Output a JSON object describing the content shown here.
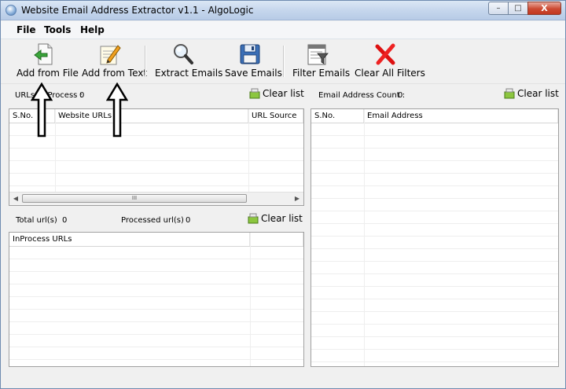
{
  "window": {
    "title": "Website Email Address Extractor v1.1 - AlgoLogic",
    "minimize": "–",
    "maximize": "□",
    "close": "X"
  },
  "menu": [
    "File",
    "Tools",
    "Help"
  ],
  "toolbar": {
    "add_from_file": "Add from File",
    "add_from_text": "Add from Text",
    "extract_emails": "Extract Emails",
    "save_emails": "Save Emails",
    "filter_emails": "Filter Emails",
    "clear_all_filters": "Clear All Filters"
  },
  "urls_panel": {
    "count_label": "URLs to Process :",
    "count_value": "0",
    "clear_label": "Clear list",
    "columns": [
      "S.No.",
      "Website URLs",
      "URL Source"
    ],
    "scroll_thumb": "III"
  },
  "progress_panel": {
    "total_label": "Total url(s)",
    "total_value": "0",
    "processed_label": "Processed url(s)",
    "processed_value": "0",
    "clear_label": "Clear list",
    "columns": [
      "InProcess URLs",
      ""
    ]
  },
  "emails_panel": {
    "count_label": "Email Address Count :",
    "count_value": "0",
    "clear_label": "Clear list",
    "columns": [
      "S.No.",
      "Email Address"
    ]
  },
  "icons": {
    "app": "globe-icon",
    "add_file": "file-arrow-icon",
    "add_text": "pencil-note-icon",
    "extract": "magnifier-icon",
    "save": "floppy-disk-icon",
    "filter": "filter-list-icon",
    "clear_filters": "red-x-icon",
    "clear_list": "eraser-icon"
  },
  "colors": {
    "titlebar": "#c4d5ec",
    "close_button": "#cc4a33",
    "annotation_arrow": "#000000"
  }
}
